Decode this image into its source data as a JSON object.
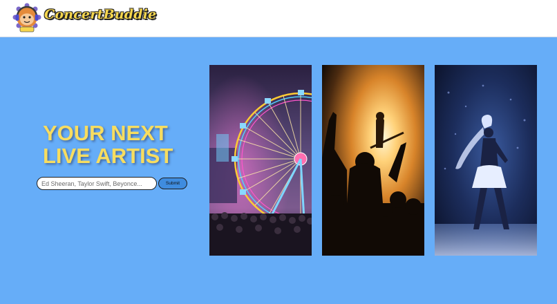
{
  "header": {
    "brand_name": "ConcertBuddie",
    "logo_icon": "monkey-headphones-icon"
  },
  "hero": {
    "title_line_1": "YOUR NEXT",
    "title_line_2": "LIVE ARTIST",
    "search_placeholder": "Ed Sheeran, Taylor Swift, Beyonce...",
    "submit_label": "Submit"
  },
  "gallery": {
    "images": [
      {
        "subject": "ferris-wheel-festival"
      },
      {
        "subject": "concert-crowd-stage-lights"
      },
      {
        "subject": "pop-singer-on-stage"
      }
    ]
  },
  "colors": {
    "background": "#66adf8",
    "title": "#f7dd60",
    "brand": "#f6d64e",
    "button": "#3f8cdf"
  }
}
